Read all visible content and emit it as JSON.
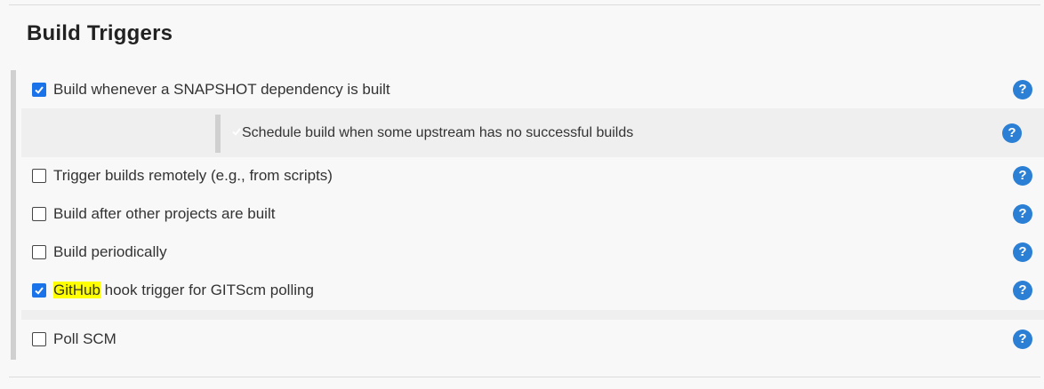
{
  "section": {
    "title": "Build Triggers"
  },
  "triggers": [
    {
      "label": "Build whenever a SNAPSHOT dependency is built",
      "checked": true
    },
    {
      "label": "Schedule build when some upstream has no successful builds",
      "checked": false
    },
    {
      "label": "Trigger builds remotely (e.g., from scripts)",
      "checked": false
    },
    {
      "label": "Build after other projects are built",
      "checked": false
    },
    {
      "label": "Build periodically",
      "checked": false
    },
    {
      "label_highlight": "GitHub",
      "label_rest": " hook trigger for GITScm polling",
      "checked": true
    },
    {
      "label": "Poll SCM",
      "checked": false
    }
  ],
  "help_glyph": "?",
  "icons": {
    "help": "help-icon",
    "check": "check-icon"
  },
  "colors": {
    "accent": "#1a73e8",
    "help": "#2b7fd4",
    "highlight": "#ffff00"
  }
}
